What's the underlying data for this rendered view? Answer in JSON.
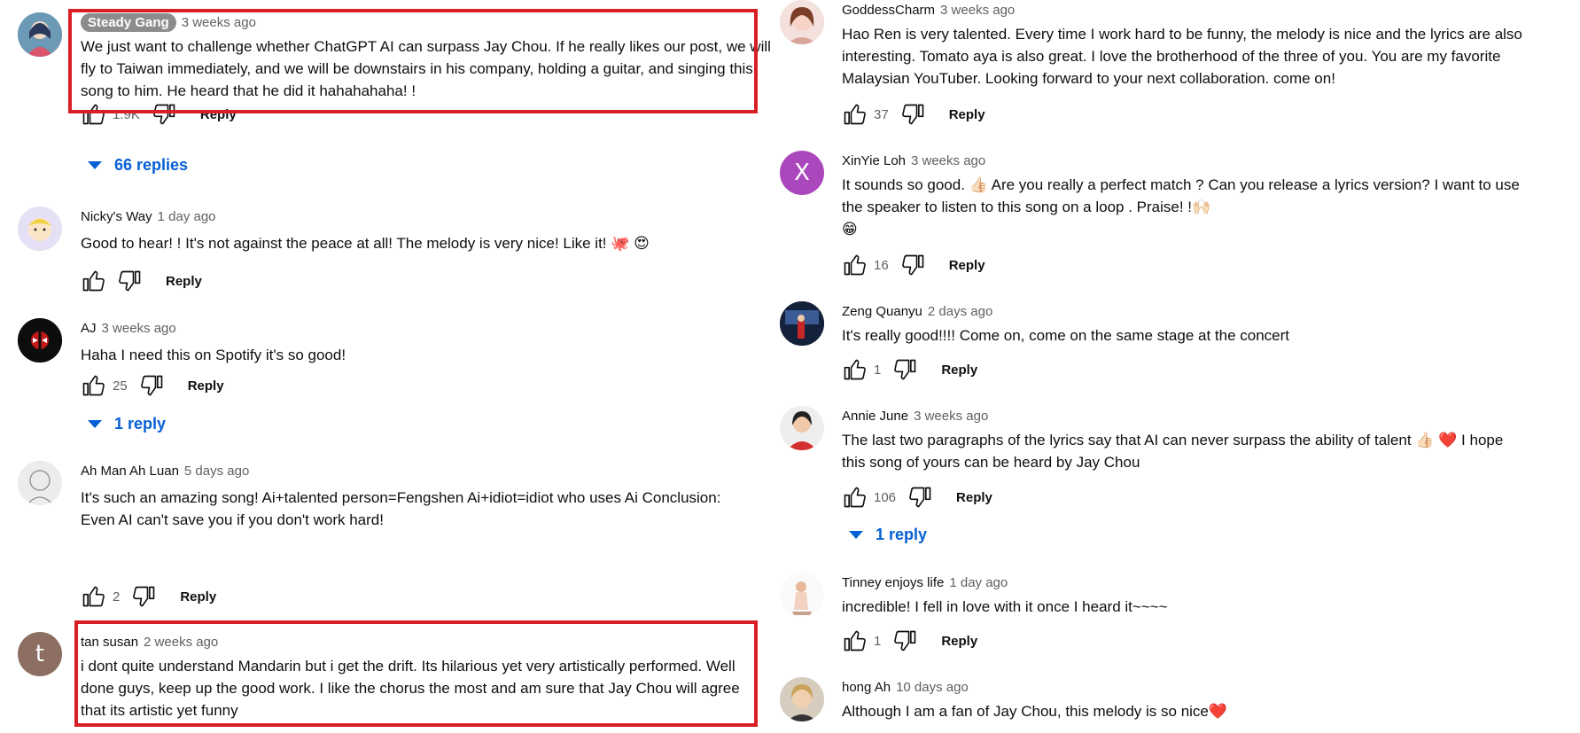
{
  "left_comments": [
    {
      "author": "Steady Gang",
      "time": "3 weeks ago",
      "text": "We just want to challenge whether ChatGPT AI can surpass Jay Chou. If he really likes our post, we will fly to Taiwan immediately, and we will be downstairs in his company, holding a guitar, and singing this song to him. He heard that he did it hahahahaha! !",
      "likes": "1.9K",
      "reply_label": "Reply",
      "replies": "66 replies",
      "avatar": "anime-girl"
    },
    {
      "author": "Nicky's Way",
      "time": "1 day ago",
      "text": "Good to hear! ! It's not against the peace at all! The melody is very nice! Like it!",
      "emoji": "🐙 😍",
      "likes": "",
      "reply_label": "Reply",
      "avatar": "cartoon-yellow"
    },
    {
      "author": "AJ",
      "time": "3 weeks ago",
      "text": "Haha I need this on Spotify it's so good!",
      "likes": "25",
      "reply_label": "Reply",
      "replies": "1 reply",
      "avatar": "deadpool"
    },
    {
      "author": "Ah Man Ah Luan",
      "time": "5 days ago",
      "text": "It's such an amazing song! Ai+talented person=Fengshen Ai+idiot=idiot who uses Ai Conclusion: Even AI can't save you if you don't work hard!",
      "likes": "2",
      "reply_label": "Reply",
      "avatar": "sketch"
    },
    {
      "author": "tan susan",
      "time": "2 weeks ago",
      "text": "i dont quite understand Mandarin but i get the drift. Its hilarious yet very artistically performed. Well done guys, keep up the good work. I like the chorus the most and am sure that Jay Chou will agree that its artistic yet funny",
      "avatar_letter": "t"
    }
  ],
  "right_comments": [
    {
      "author": "GoddessCharm",
      "time": "3 weeks ago",
      "text": "Hao Ren is very talented. Every time I work hard to be funny, the melody is nice and the lyrics are also interesting. Tomato aya is also great. I love the brotherhood of the three of you. You are my favorite Malaysian YouTuber. Looking forward to your next collaboration. come on!",
      "likes": "37",
      "reply_label": "Reply"
    },
    {
      "author": "XinYie Loh",
      "time": "3 weeks ago",
      "text": "It sounds so good. 👍🏻 Are you really a perfect match ? Can you release a lyrics version? I want to use the speaker to listen to this song on a loop . Praise! !🙌🏻",
      "text2": "😁",
      "likes": "16",
      "reply_label": "Reply",
      "avatar_letter": "X"
    },
    {
      "author": "Zeng Quanyu",
      "time": "2 days ago",
      "text": "It's really good!!!! Come on, come on the same stage at the concert",
      "likes": "1",
      "reply_label": "Reply"
    },
    {
      "author": "Annie June",
      "time": "3 weeks ago",
      "text": "The last two paragraphs of the lyrics say that AI can never surpass the ability of talent 👍🏻 ❤️ I hope this song of yours can be heard by Jay Chou",
      "likes": "106",
      "reply_label": "Reply",
      "replies": "1 reply"
    },
    {
      "author": "Tinney enjoys life",
      "time": "1 day ago",
      "text": "incredible! I fell in love with it once I heard it~~~~",
      "likes": "1",
      "reply_label": "Reply"
    },
    {
      "author": "hong Ah",
      "time": "10 days ago",
      "text": "Although I am a fan of Jay Chou, this melody is so nice❤️"
    }
  ],
  "colors": {
    "highlight": "#d81f26",
    "link": "#065fd4",
    "meta": "#606060"
  }
}
